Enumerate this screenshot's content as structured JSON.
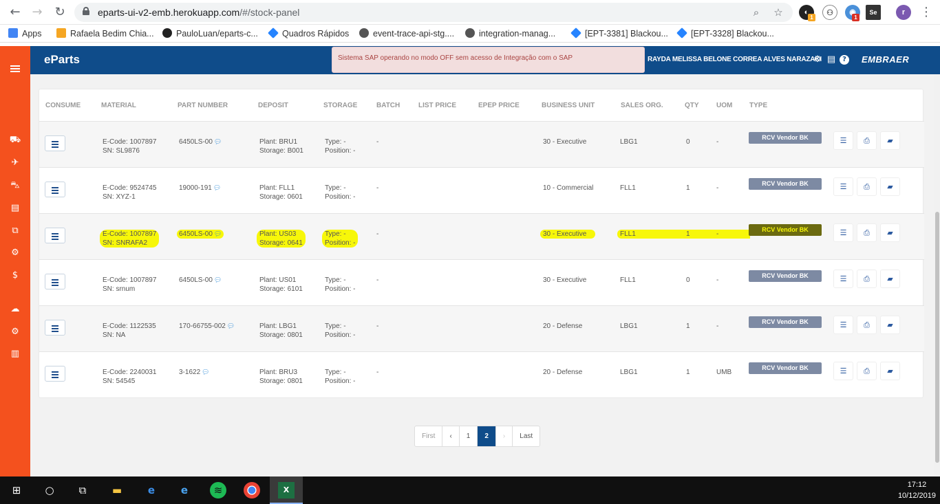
{
  "browser": {
    "url_host": "eparts-ui-v2-emb.herokuapp.com",
    "url_path": "/#/stock-panel",
    "extension_badges": [
      "1",
      "1"
    ]
  },
  "bookmarks": [
    {
      "label": "Apps",
      "icon": "apps-grid-icon",
      "color": "#4285f4"
    },
    {
      "label": "Rafaela Bedim Chia...",
      "icon": "folder-icon",
      "color": "#f5a623"
    },
    {
      "label": "PauloLuan/eparts-c...",
      "icon": "github-icon",
      "color": "#222222"
    },
    {
      "label": "Quadros Rápidos",
      "icon": "jira-icon",
      "color": "#2684ff"
    },
    {
      "label": "event-trace-api-stg....",
      "icon": "globe-icon",
      "color": "#555555"
    },
    {
      "label": "integration-manag...",
      "icon": "globe-icon",
      "color": "#555555"
    },
    {
      "label": "[EPT-3381] Blackou...",
      "icon": "jira-icon",
      "color": "#2684ff"
    },
    {
      "label": "[EPT-3328] Blackou...",
      "icon": "jira-icon",
      "color": "#2684ff"
    }
  ],
  "app": {
    "brand": "eParts",
    "alert": "Sistema SAP operando no modo OFF sem acesso de Integração com o SAP",
    "user": "RAYDA MELISSA BELONE CORREA ALVES NARAZAKI",
    "logo": "EMBRAER",
    "accent": "#0f4c8a",
    "sidebar_color": "#f4511e",
    "highlight_color": "#f7f70a"
  },
  "table": {
    "headers": [
      "CONSUME",
      "MATERIAL",
      "PART NUMBER",
      "DEPOSIT",
      "STORAGE",
      "BATCH",
      "LIST PRICE",
      "EPEP PRICE",
      "BUSINESS UNIT",
      "SALES ORG.",
      "QTY",
      "UOM",
      "TYPE"
    ],
    "rows": [
      {
        "ecode": "E-Code: 1007897",
        "sn": "SN: SL9876",
        "part": "6450LS-00",
        "plant": "Plant: BRU1",
        "storage": "Storage: B001",
        "stype": "Type: -",
        "spos": "Position: -",
        "batch": "-",
        "bu": "30 - Executive",
        "sorg": "LBG1",
        "qty": "0",
        "uom": "-",
        "type": "RCV Vendor BK"
      },
      {
        "ecode": "E-Code: 9524745",
        "sn": "SN: XYZ-1",
        "part": "19000-191",
        "plant": "Plant: FLL1",
        "storage": "Storage: 0601",
        "stype": "Type: -",
        "spos": "Position: -",
        "batch": "-",
        "bu": "10 - Commercial",
        "sorg": "FLL1",
        "qty": "1",
        "uom": "-",
        "type": "RCV Vendor BK"
      },
      {
        "ecode": "E-Code: 1007897",
        "sn": "SN: SNRAFA2",
        "part": "6450LS-00",
        "plant": "Plant: US03",
        "storage": "Storage: 0641",
        "stype": "Type: -",
        "spos": "Position: -",
        "batch": "-",
        "bu": "30 - Executive",
        "sorg": "FLL1",
        "qty": "1",
        "uom": "-",
        "type": "RCV Vendor BK",
        "highlighted": true
      },
      {
        "ecode": "E-Code: 1007897",
        "sn": "SN: srnum",
        "part": "6450LS-00",
        "plant": "Plant: US01",
        "storage": "Storage: 6101",
        "stype": "Type: -",
        "spos": "Position: -",
        "batch": "-",
        "bu": "30 - Executive",
        "sorg": "FLL1",
        "qty": "0",
        "uom": "-",
        "type": "RCV Vendor BK"
      },
      {
        "ecode": "E-Code: 1122535",
        "sn": "SN: NA",
        "part": "170-66755-002",
        "plant": "Plant: LBG1",
        "storage": "Storage: 0801",
        "stype": "Type: -",
        "spos": "Position: -",
        "batch": "-",
        "bu": "20 - Defense",
        "sorg": "LBG1",
        "qty": "1",
        "uom": "-",
        "type": "RCV Vendor BK"
      },
      {
        "ecode": "E-Code: 2240031",
        "sn": "SN: 54545",
        "part": "3-1622",
        "plant": "Plant: BRU3",
        "storage": "Storage: 0801",
        "stype": "Type: -",
        "spos": "Position: -",
        "batch": "-",
        "bu": "20 - Defense",
        "sorg": "LBG1",
        "qty": "1",
        "uom": "UMB",
        "type": "RCV Vendor BK"
      }
    ]
  },
  "pagination": {
    "first": "First",
    "prev": "‹",
    "pages": [
      "1",
      "2"
    ],
    "current": "2",
    "next": "›",
    "last": "Last"
  },
  "taskbar": {
    "time": "17:12",
    "date": "10/12/2019"
  }
}
